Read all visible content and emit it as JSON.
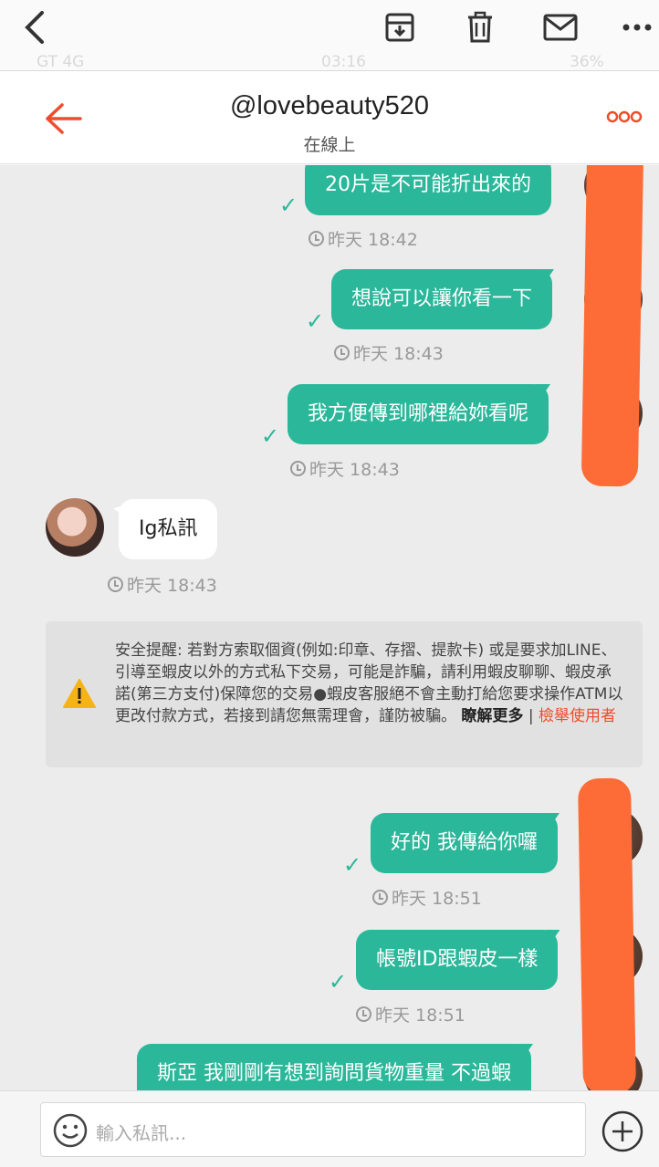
{
  "outer_toolbar": {
    "back_icon": "chevron-left-icon",
    "actions": [
      "archive-icon",
      "trash-icon",
      "mail-icon",
      "more-horizontal-icon"
    ],
    "ghost_status": {
      "carrier": "GT 4G",
      "time": "03:16",
      "battery": "36%"
    }
  },
  "header": {
    "title": "@lovebeauty520",
    "subtitle": "在線上",
    "accent_color": "#ee4d2d"
  },
  "messages": [
    {
      "side": "out",
      "text": "20片是不可能折出來的",
      "time": "昨天 18:42"
    },
    {
      "side": "out",
      "text": "想說可以讓你看一下",
      "time": "昨天 18:43"
    },
    {
      "side": "out",
      "text": "我方便傳到哪裡給妳看呢",
      "time": "昨天 18:43"
    },
    {
      "side": "in",
      "text": "Ig私訊",
      "time": "昨天 18:43"
    },
    {
      "side": "out",
      "text": "好的 我傳給你囉",
      "time": "昨天 18:51"
    },
    {
      "side": "out",
      "text": "帳號ID跟蝦皮一樣",
      "time": "昨天 18:51"
    },
    {
      "side": "out",
      "text": "斯亞 我剛剛有想到詢問貨物重量 不過蝦",
      "time": ""
    }
  ],
  "safety_notice": {
    "text": "安全提醒: 若對方索取個資(例如:印章、存摺、提款卡) 或是要求加LINE、引導至蝦皮以外的方式私下交易，可能是詐騙，請利用蝦皮聊聊、蝦皮承諾(第三方支付)保障您的交易●蝦皮客服絕不會主動打給您要求操作ATM以更改付款方式，若接到請您無需理會，謹防被騙。",
    "learn_more": "瞭解更多",
    "separator": "|",
    "report": "檢舉使用者"
  },
  "input": {
    "placeholder": "輸入私訊..."
  },
  "colors": {
    "bubble_out": "#2bb79a",
    "chat_bg": "#ececec",
    "redaction": "#fd6c36"
  }
}
